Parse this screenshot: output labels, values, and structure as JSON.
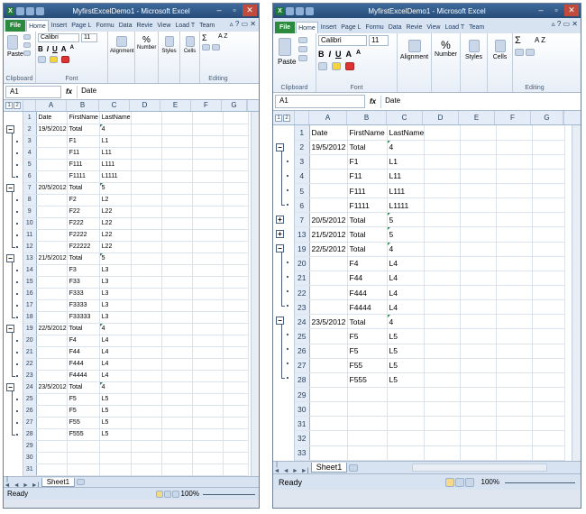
{
  "app": {
    "title": "MyfirstExcelDemo1 - Microsoft Excel"
  },
  "ribbon_tabs_w1": [
    "File",
    "Home",
    "Insert",
    "Page L",
    "Formu",
    "Data",
    "Revie",
    "View",
    "Load T",
    "Team"
  ],
  "ribbon_tabs_w2": [
    "File",
    "Home",
    "Insert",
    "Page L",
    "Formu",
    "Data",
    "Revie",
    "View",
    "Load T",
    "Team"
  ],
  "ribbon": {
    "clipboard": "Clipboard",
    "paste": "Paste",
    "font_group": "Font",
    "font_name": "Calibri",
    "font_size": "11",
    "bold": "B",
    "italic": "I",
    "underline": "U",
    "grow": "A",
    "shrink": "A",
    "alignment": "Alignment",
    "number": "Number",
    "styles": "Styles",
    "cells": "Cells",
    "editing": "Editing",
    "sum": "Σ",
    "sort": "A Z",
    "percent": "%"
  },
  "formula_bar": {
    "name_box": "A1",
    "fx": "fx",
    "value": "Date"
  },
  "columns_w1": [
    "A",
    "B",
    "C",
    "D",
    "E",
    "F",
    "G"
  ],
  "columns_w2": [
    "A",
    "B",
    "C",
    "D",
    "E",
    "F",
    "G"
  ],
  "outline_levels": [
    "1",
    "2"
  ],
  "sheet": {
    "tab": "Sheet1",
    "status": "Ready",
    "zoom": "100%",
    "nav": [
      "|◄",
      "◄",
      "►",
      "►|"
    ]
  },
  "grid_w1": [
    {
      "r": "1",
      "a": "Date",
      "b": "FirstName",
      "c": "LastName"
    },
    {
      "r": "2",
      "a": "19/5/2012",
      "b": "Total",
      "c": "4",
      "t": true
    },
    {
      "r": "3",
      "a": "",
      "b": "F1",
      "c": "L1"
    },
    {
      "r": "4",
      "a": "",
      "b": "F11",
      "c": "L11"
    },
    {
      "r": "5",
      "a": "",
      "b": "F111",
      "c": "L111"
    },
    {
      "r": "6",
      "a": "",
      "b": "F1111",
      "c": "L1111"
    },
    {
      "r": "7",
      "a": "20/5/2012",
      "b": "Total",
      "c": "5",
      "t": true
    },
    {
      "r": "8",
      "a": "",
      "b": "F2",
      "c": "L2"
    },
    {
      "r": "9",
      "a": "",
      "b": "F22",
      "c": "L22"
    },
    {
      "r": "10",
      "a": "",
      "b": "F222",
      "c": "L22"
    },
    {
      "r": "11",
      "a": "",
      "b": "F2222",
      "c": "L22"
    },
    {
      "r": "12",
      "a": "",
      "b": "F22222",
      "c": "L22"
    },
    {
      "r": "13",
      "a": "21/5/2012",
      "b": "Total",
      "c": "5",
      "t": true
    },
    {
      "r": "14",
      "a": "",
      "b": "F3",
      "c": "L3"
    },
    {
      "r": "15",
      "a": "",
      "b": "F33",
      "c": "L3"
    },
    {
      "r": "16",
      "a": "",
      "b": "F333",
      "c": "L3"
    },
    {
      "r": "17",
      "a": "",
      "b": "F3333",
      "c": "L3"
    },
    {
      "r": "18",
      "a": "",
      "b": "F33333",
      "c": "L3"
    },
    {
      "r": "19",
      "a": "22/5/2012",
      "b": "Total",
      "c": "4",
      "t": true
    },
    {
      "r": "20",
      "a": "",
      "b": "F4",
      "c": "L4"
    },
    {
      "r": "21",
      "a": "",
      "b": "F44",
      "c": "L4"
    },
    {
      "r": "22",
      "a": "",
      "b": "F444",
      "c": "L4"
    },
    {
      "r": "23",
      "a": "",
      "b": "F4444",
      "c": "L4"
    },
    {
      "r": "24",
      "a": "23/5/2012",
      "b": "Total",
      "c": "4",
      "t": true
    },
    {
      "r": "25",
      "a": "",
      "b": "F5",
      "c": "L5"
    },
    {
      "r": "26",
      "a": "",
      "b": "F5",
      "c": "L5"
    },
    {
      "r": "27",
      "a": "",
      "b": "F55",
      "c": "L5"
    },
    {
      "r": "28",
      "a": "",
      "b": "F555",
      "c": "L5"
    },
    {
      "r": "29",
      "a": "",
      "b": "",
      "c": ""
    },
    {
      "r": "30",
      "a": "",
      "b": "",
      "c": ""
    },
    {
      "r": "31",
      "a": "",
      "b": "",
      "c": ""
    }
  ],
  "grid_w2": [
    {
      "r": "1",
      "a": "Date",
      "b": "FirstName",
      "c": "LastName"
    },
    {
      "r": "2",
      "a": "19/5/2012",
      "b": "Total",
      "c": "4",
      "t": true
    },
    {
      "r": "3",
      "a": "",
      "b": "F1",
      "c": "L1"
    },
    {
      "r": "4",
      "a": "",
      "b": "F11",
      "c": "L11"
    },
    {
      "r": "5",
      "a": "",
      "b": "F111",
      "c": "L111"
    },
    {
      "r": "6",
      "a": "",
      "b": "F1111",
      "c": "L1111"
    },
    {
      "r": "7",
      "a": "20/5/2012",
      "b": "Total",
      "c": "5",
      "t": true
    },
    {
      "r": "13",
      "a": "21/5/2012",
      "b": "Total",
      "c": "5",
      "t": true
    },
    {
      "r": "19",
      "a": "22/5/2012",
      "b": "Total",
      "c": "4",
      "t": true
    },
    {
      "r": "20",
      "a": "",
      "b": "F4",
      "c": "L4"
    },
    {
      "r": "21",
      "a": "",
      "b": "F44",
      "c": "L4"
    },
    {
      "r": "22",
      "a": "",
      "b": "F444",
      "c": "L4"
    },
    {
      "r": "23",
      "a": "",
      "b": "F4444",
      "c": "L4"
    },
    {
      "r": "24",
      "a": "23/5/2012",
      "b": "Total",
      "c": "4",
      "t": true
    },
    {
      "r": "25",
      "a": "",
      "b": "F5",
      "c": "L5"
    },
    {
      "r": "26",
      "a": "",
      "b": "F5",
      "c": "L5"
    },
    {
      "r": "27",
      "a": "",
      "b": "F55",
      "c": "L5"
    },
    {
      "r": "28",
      "a": "",
      "b": "F555",
      "c": "L5"
    },
    {
      "r": "29",
      "a": "",
      "b": "",
      "c": ""
    },
    {
      "r": "30",
      "a": "",
      "b": "",
      "c": ""
    },
    {
      "r": "31",
      "a": "",
      "b": "",
      "c": ""
    },
    {
      "r": "32",
      "a": "",
      "b": "",
      "c": ""
    },
    {
      "r": "33",
      "a": "",
      "b": "",
      "c": ""
    }
  ],
  "outline_w2_buttons": [
    "−",
    "+",
    "+",
    "−",
    "−"
  ],
  "colors": {
    "title_bar": "#2f5a8a",
    "file_tab": "#2b8a3e",
    "header_bg": "#e4ecf7",
    "error_triangle": "#2e8b57"
  }
}
